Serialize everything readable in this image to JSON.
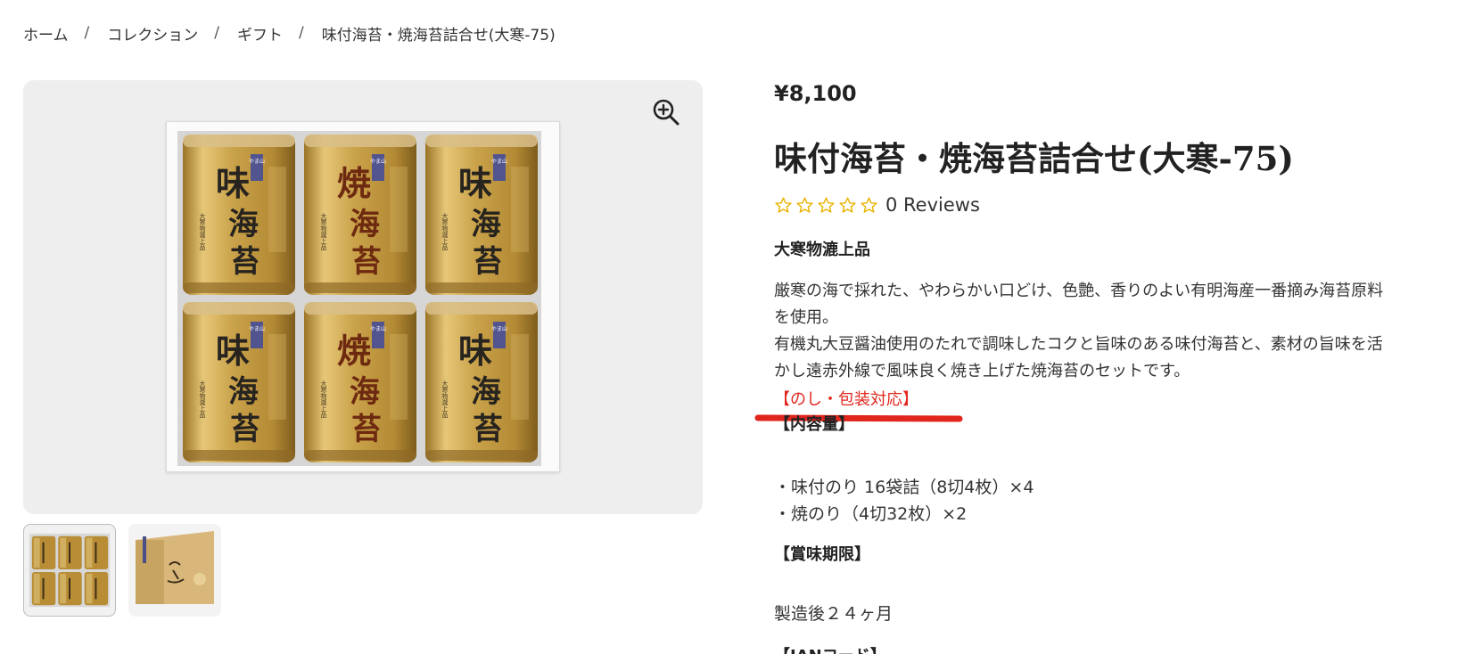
{
  "breadcrumb": {
    "home": "ホーム",
    "collection": "コレクション",
    "gift": "ギフト",
    "current": "味付海苔・焼海苔詰合せ(大寒-75)",
    "separator": "/"
  },
  "gallery": {
    "zoom_icon": "zoom-in-icon",
    "can_brand_tag": "やま山",
    "can_maker": "大寒物瀧上品",
    "cans": [
      {
        "glyph_top": "味",
        "glyph_mid": "海",
        "glyph_bot": "苔",
        "accent": "#27231f"
      },
      {
        "glyph_top": "焼",
        "glyph_mid": "海",
        "glyph_bot": "苔",
        "accent": "#6e2a10"
      },
      {
        "glyph_top": "味",
        "glyph_mid": "海",
        "glyph_bot": "苔",
        "accent": "#27231f"
      },
      {
        "glyph_top": "味",
        "glyph_mid": "海",
        "glyph_bot": "苔",
        "accent": "#27231f"
      },
      {
        "glyph_top": "焼",
        "glyph_mid": "海",
        "glyph_bot": "苔",
        "accent": "#6e2a10"
      },
      {
        "glyph_top": "味",
        "glyph_mid": "海",
        "glyph_bot": "苔",
        "accent": "#27231f"
      }
    ],
    "thumb_count": 2
  },
  "product": {
    "price": "¥8,100",
    "title": "味付海苔・焼海苔詰合せ(大寒-75)",
    "rating_stars": 0,
    "reviews_label": "0 Reviews",
    "brand": "大寒物漉上品",
    "desc_line1": "厳寒の海で採れた、やわらかい口どけ、色艶、香りのよい有明海産一番摘み海苔原料",
    "desc_line2": "を使用。",
    "desc_line3": "有機丸大豆醤油使用のたれで調味したコクと旨味のある味付海苔と、素材の旨味を活",
    "desc_line4": "かし遠赤外線で風味良く焼き上げた焼海苔のセットです。",
    "noshi": "【のし・包装対応】",
    "contents_heading": "【内容量】",
    "contents_line1": "・味付のり 16袋詰（8切4枚）×4",
    "contents_line2": "・焼のり（4切32枚）×2",
    "shelf_heading": "【賞味期限】",
    "shelf_life": "製造後２４ヶ月",
    "jan_heading": "【JANコード】"
  },
  "colors": {
    "star_outline": "#e8b200",
    "accent_red": "#e0261d",
    "gold_can": "#c9a24a",
    "background_panel": "#eeeeef"
  }
}
